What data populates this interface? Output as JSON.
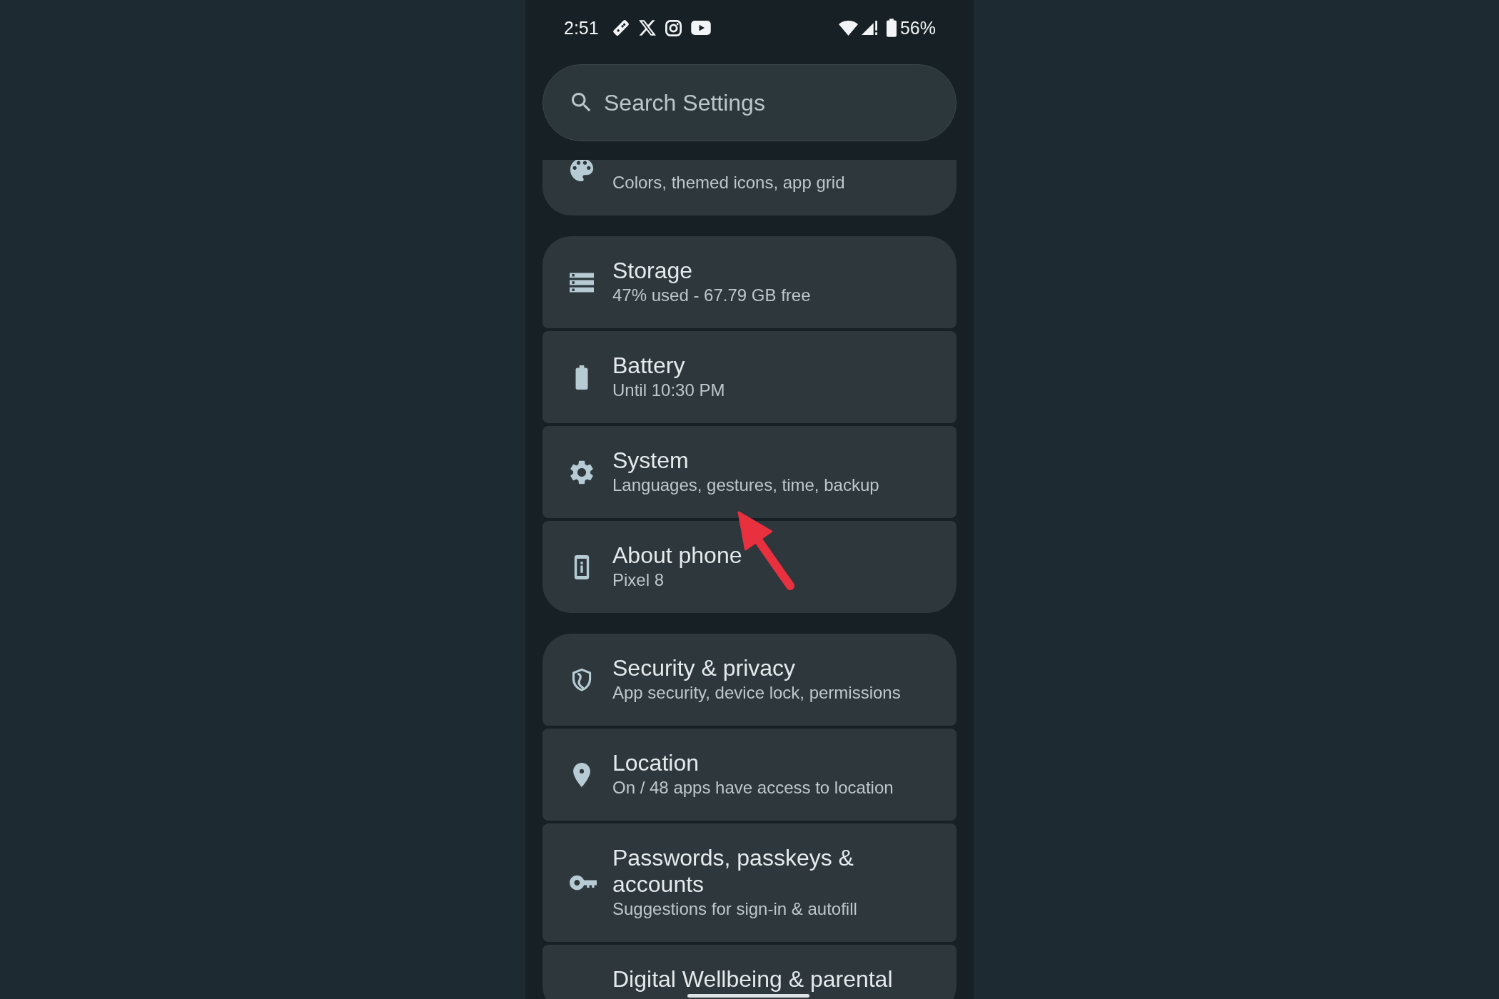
{
  "status_bar": {
    "time": "2:51",
    "battery": "56%"
  },
  "search": {
    "placeholder": "Search Settings"
  },
  "groups": [
    {
      "items": [
        {
          "subtitle": "Colors, themed icons, app grid"
        }
      ]
    },
    {
      "items": [
        {
          "title": "Storage",
          "subtitle": "47% used - 67.79 GB free"
        },
        {
          "title": "Battery",
          "subtitle": "Until 10:30 PM"
        },
        {
          "title": "System",
          "subtitle": "Languages, gestures, time, backup"
        },
        {
          "title": "About phone",
          "subtitle": "Pixel 8"
        }
      ]
    },
    {
      "items": [
        {
          "title": "Security & privacy",
          "subtitle": "App security, device lock, permissions"
        },
        {
          "title": "Location",
          "subtitle": "On / 48 apps have access to location"
        },
        {
          "title": "Passwords, passkeys & accounts",
          "subtitle": "Suggestions for sign-in & autofill"
        },
        {
          "title": "Digital Wellbeing & parental"
        }
      ]
    }
  ]
}
